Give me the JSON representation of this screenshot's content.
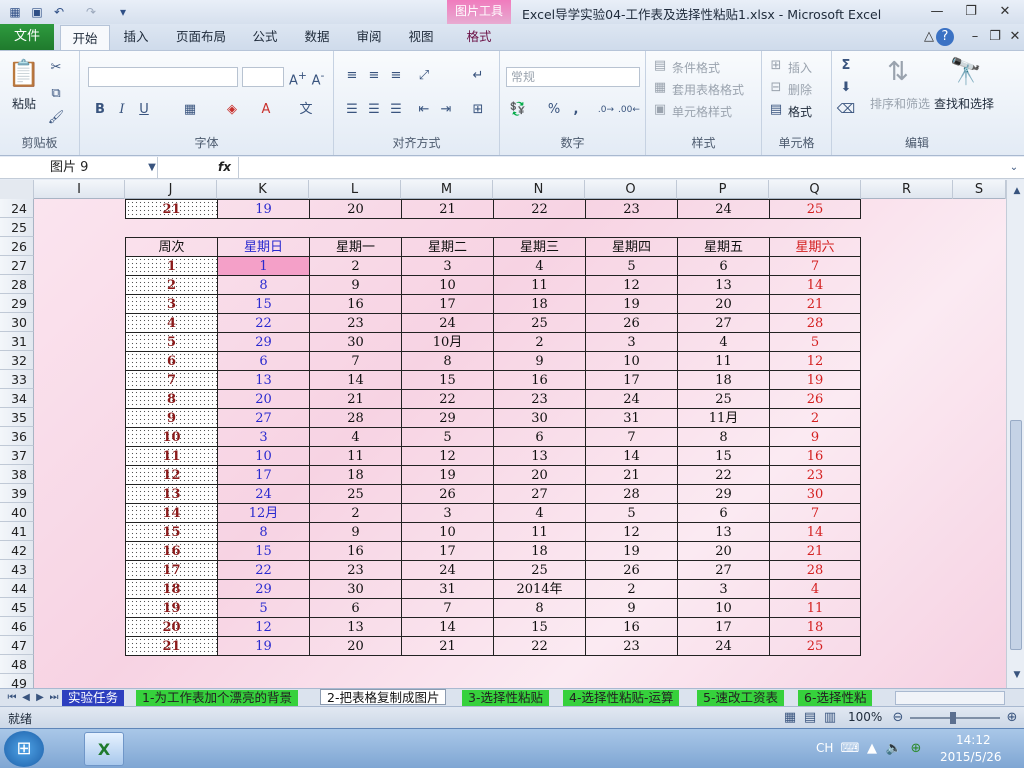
{
  "window": {
    "title": "Excel导学实验04-工作表及选择性粘贴1.xlsx  -  Microsoft Excel",
    "context_tool": "图片工具",
    "context_tab": "格式"
  },
  "tabs": {
    "file": "文件",
    "home": "开始",
    "insert": "插入",
    "layout": "页面布局",
    "formulas": "公式",
    "data": "数据",
    "review": "审阅",
    "view": "视图"
  },
  "ribbon": {
    "clipboard": {
      "label": "剪贴板",
      "paste": "粘贴"
    },
    "font": {
      "label": "字体",
      "bold": "B",
      "italic": "I",
      "underline": "U"
    },
    "align": {
      "label": "对齐方式"
    },
    "number": {
      "label": "数字",
      "format": "常规",
      "percent": "%",
      "comma": ","
    },
    "styles": {
      "label": "样式",
      "cond": "条件格式",
      "table": "套用表格格式",
      "cell": "单元格样式"
    },
    "cells": {
      "label": "单元格",
      "insert": "插入",
      "delete": "删除",
      "format": "格式"
    },
    "edit": {
      "label": "编辑",
      "sum": "Σ",
      "sort": "排序和筛选",
      "find": "查找和选择"
    }
  },
  "formula_bar": {
    "name": "图片 9",
    "fx": "fx",
    "value": ""
  },
  "columns": [
    "I",
    "J",
    "K",
    "L",
    "M",
    "N",
    "O",
    "P",
    "Q",
    "R",
    "S"
  ],
  "rows": [
    "24",
    "25",
    "26",
    "27",
    "28",
    "29",
    "30",
    "31",
    "32",
    "33",
    "34",
    "35",
    "36",
    "37",
    "38",
    "39",
    "40",
    "41",
    "42",
    "43",
    "44",
    "45",
    "46",
    "47",
    "48",
    "49"
  ],
  "calendar": {
    "row24": [
      "21",
      "19",
      "20",
      "21",
      "22",
      "23",
      "24",
      "25"
    ],
    "header": [
      "周次",
      "星期日",
      "星期一",
      "星期二",
      "星期三",
      "星期四",
      "星期五",
      "星期六"
    ],
    "weeks": [
      [
        "1",
        "1",
        "2",
        "3",
        "4",
        "5",
        "6",
        "7"
      ],
      [
        "2",
        "8",
        "9",
        "10",
        "11",
        "12",
        "13",
        "14"
      ],
      [
        "3",
        "15",
        "16",
        "17",
        "18",
        "19",
        "20",
        "21"
      ],
      [
        "4",
        "22",
        "23",
        "24",
        "25",
        "26",
        "27",
        "28"
      ],
      [
        "5",
        "29",
        "30",
        "10月",
        "2",
        "3",
        "4",
        "5"
      ],
      [
        "6",
        "6",
        "7",
        "8",
        "9",
        "10",
        "11",
        "12"
      ],
      [
        "7",
        "13",
        "14",
        "15",
        "16",
        "17",
        "18",
        "19"
      ],
      [
        "8",
        "20",
        "21",
        "22",
        "23",
        "24",
        "25",
        "26"
      ],
      [
        "9",
        "27",
        "28",
        "29",
        "30",
        "31",
        "11月",
        "2"
      ],
      [
        "10",
        "3",
        "4",
        "5",
        "6",
        "7",
        "8",
        "9"
      ],
      [
        "11",
        "10",
        "11",
        "12",
        "13",
        "14",
        "15",
        "16"
      ],
      [
        "12",
        "17",
        "18",
        "19",
        "20",
        "21",
        "22",
        "23"
      ],
      [
        "13",
        "24",
        "25",
        "26",
        "27",
        "28",
        "29",
        "30"
      ],
      [
        "14",
        "12月",
        "2",
        "3",
        "4",
        "5",
        "6",
        "7"
      ],
      [
        "15",
        "8",
        "9",
        "10",
        "11",
        "12",
        "13",
        "14"
      ],
      [
        "16",
        "15",
        "16",
        "17",
        "18",
        "19",
        "20",
        "21"
      ],
      [
        "17",
        "22",
        "23",
        "24",
        "25",
        "26",
        "27",
        "28"
      ],
      [
        "18",
        "29",
        "30",
        "31",
        "2014年",
        "2",
        "3",
        "4"
      ],
      [
        "19",
        "5",
        "6",
        "7",
        "8",
        "9",
        "10",
        "11"
      ],
      [
        "20",
        "12",
        "13",
        "14",
        "15",
        "16",
        "17",
        "18"
      ],
      [
        "21",
        "19",
        "20",
        "21",
        "22",
        "23",
        "24",
        "25"
      ]
    ]
  },
  "sheet_tabs": [
    "实验任务",
    "1-为工作表加个漂亮的背景",
    "2-把表格复制成图片",
    "3-选择性粘贴",
    "4-选择性粘贴-运算",
    "5-速改工资表",
    "6-选择性粘"
  ],
  "status": {
    "ready": "就绪",
    "zoom": "100%"
  },
  "taskbar": {
    "lang": "CH",
    "time": "14:12",
    "date": "2015/5/26"
  }
}
